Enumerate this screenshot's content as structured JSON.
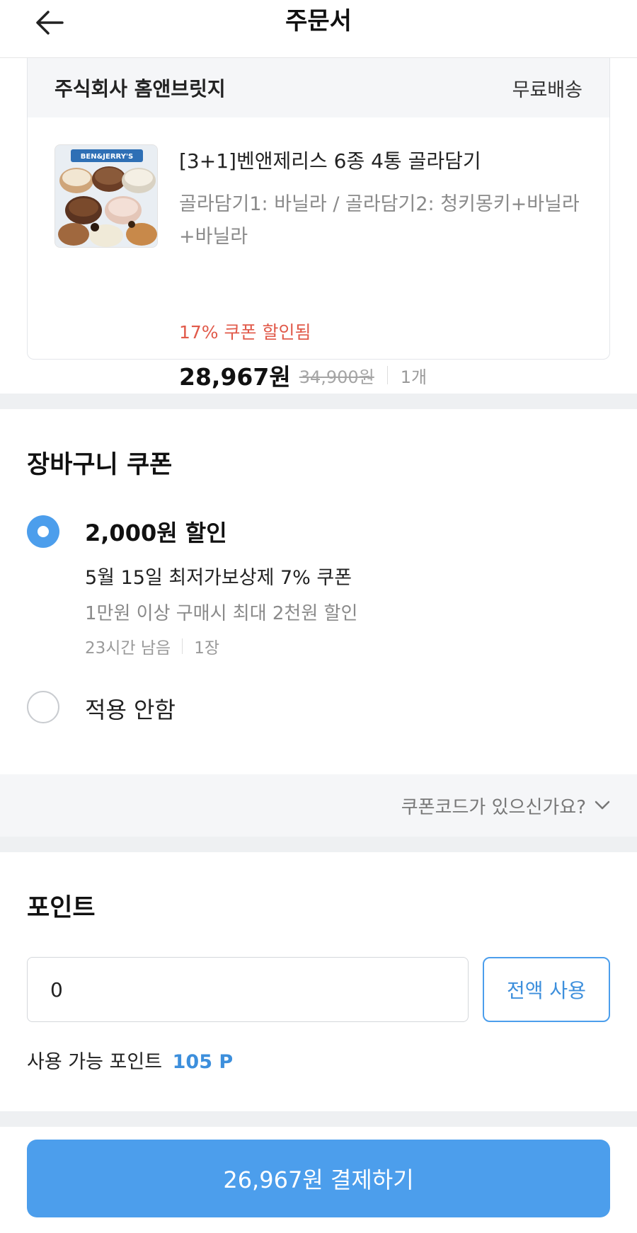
{
  "header": {
    "title": "주문서",
    "back_icon": "arrow-left-icon"
  },
  "seller": {
    "name": "주식회사 홈앤브릿지",
    "shipping": "무료배송"
  },
  "product": {
    "name": "[3+1]벤앤제리스 6종 4통 골라담기",
    "option": "골라담기1: 바닐라 / 골라담기2: 청키몽키+바닐라+바닐라",
    "discount_note": "17% 쿠폰 할인됨",
    "price": "28,967원",
    "original_price": "34,900원",
    "quantity": "1개",
    "thumbnail_logo": "BEN&JERRY'S",
    "discount_color": "#e15a4a"
  },
  "cart_coupon": {
    "title": "장바구니 쿠폰",
    "selected_option": {
      "amount": "2,000원 할인",
      "name": "5월 15일 최저가보상제 7% 쿠폰",
      "condition": "1만원 이상 구매시 최대 2천원 할인",
      "remaining": "23시간 남음",
      "count": "1장",
      "selected": true
    },
    "none_option": {
      "label": "적용 안함",
      "selected": false
    },
    "coupon_code_link": "쿠폰코드가 있으신가요?"
  },
  "points": {
    "title": "포인트",
    "input_value": "0",
    "use_all_label": "전액 사용",
    "available_label": "사용 가능 포인트",
    "available_value": "105 P"
  },
  "pay_button": {
    "label": "26,967원 결제하기"
  },
  "colors": {
    "accent": "#4c9eec",
    "discount": "#e15a4a"
  }
}
